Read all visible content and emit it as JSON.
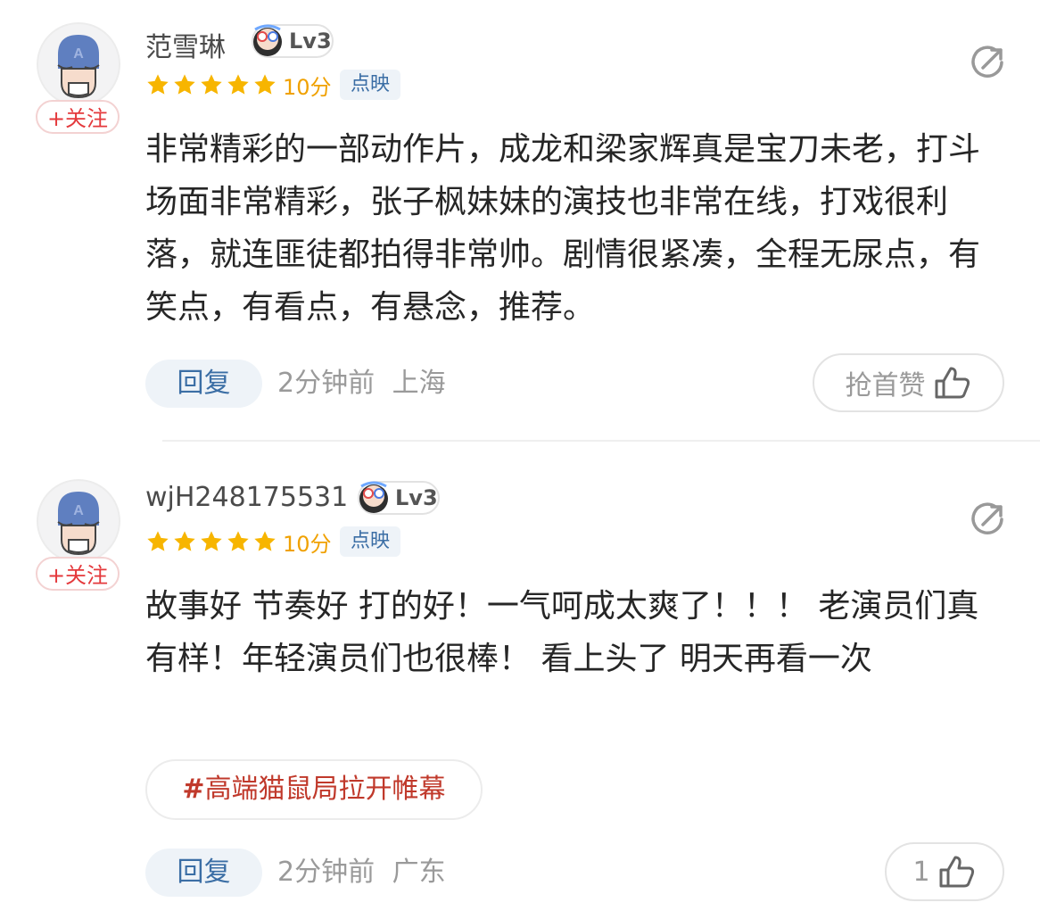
{
  "comments": [
    {
      "username": "范雪琳",
      "level": "Lv3",
      "rating_stars": 5,
      "score": "10分",
      "source": "点映",
      "follow_label": "+关注",
      "content": "非常精彩的一部动作片，成龙和梁家辉真是宝刀未老，打斗场面非常精彩，张子枫妹妹的演技也非常在线，打戏很利落，就连匪徒都拍得非常帅。剧情很紧凑，全程无尿点，有笑点，有看点，有悬念，推荐。",
      "reply_label": "回复",
      "time": "2分钟前",
      "location": "上海",
      "like_label": "抢首赞"
    },
    {
      "username": "wjH248175531",
      "level": "Lv3",
      "rating_stars": 5,
      "score": "10分",
      "source": "点映",
      "follow_label": "+关注",
      "content": "故事好 节奏好 打的好！一气呵成太爽了！！！ 老演员们真有样！年轻演员们也很棒！ 看上头了 明天再看一次",
      "topic_hash": "#",
      "topic": "高端猫鼠局拉开帷幕",
      "reply_label": "回复",
      "time": "2分钟前",
      "location": "广东",
      "like_label": "1"
    }
  ],
  "colors": {
    "star": "#f7b500",
    "accent_red": "#e4393c",
    "link_blue": "#3b6ea5",
    "muted": "#9a9a9a"
  },
  "icons": [
    "captain-america-avatar-icon",
    "star-icon",
    "share-icon",
    "thumbs-up-icon",
    "level-badge-icon"
  ]
}
